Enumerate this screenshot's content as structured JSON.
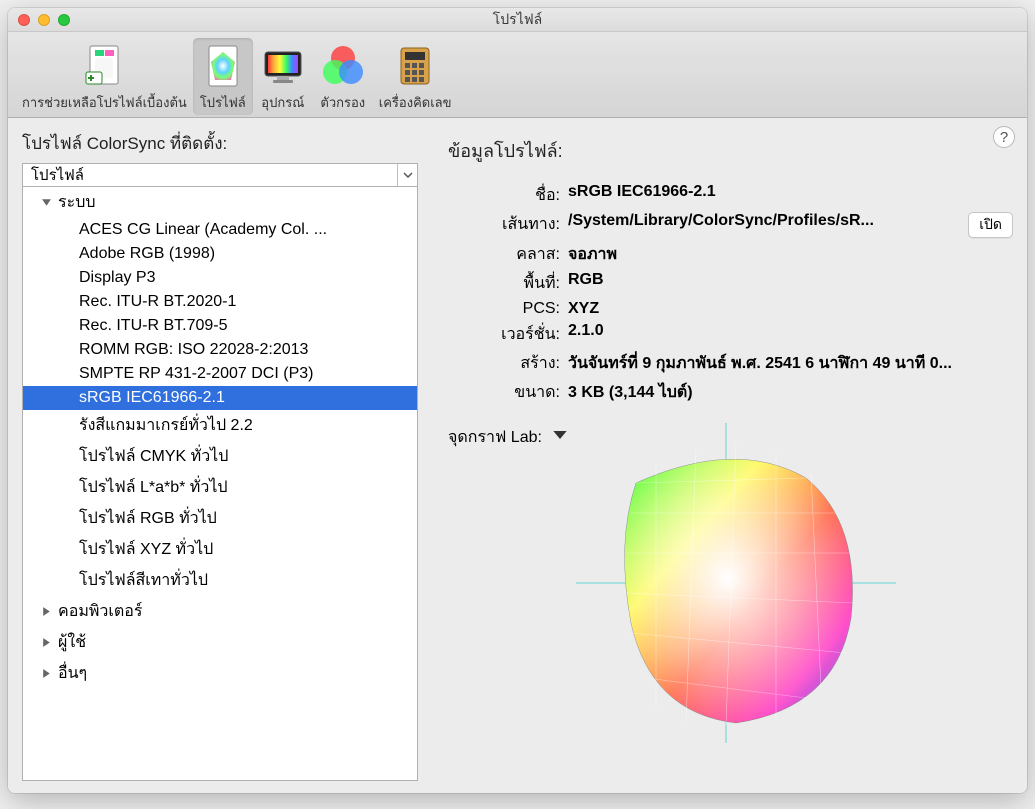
{
  "window": {
    "title": "โปรไฟล์"
  },
  "toolbar": {
    "items": [
      {
        "label": "การช่วยเหลือโปรไฟล์เบื้องต้น"
      },
      {
        "label": "โปรไฟล์"
      },
      {
        "label": "อุปกรณ์"
      },
      {
        "label": "ตัวกรอง"
      },
      {
        "label": "เครื่องคิดเลข"
      }
    ]
  },
  "left": {
    "title": "โปรไฟล์ ColorSync ที่ติดตั้ง:",
    "select_label": "โปรไฟล์",
    "groups": [
      {
        "name": "ระบบ",
        "expanded": true,
        "items": [
          "ACES CG Linear (Academy Col. ...",
          "Adobe RGB (1998)",
          "Display P3",
          "Rec. ITU-R BT.2020-1",
          "Rec. ITU-R BT.709-5",
          "ROMM RGB: ISO 22028-2:2013",
          "SMPTE RP 431-2-2007 DCI (P3)",
          "sRGB IEC61966-2.1",
          "รังสีแกมมาเกรย์ทั่วไป 2.2",
          "โปรไฟล์ CMYK ทั่วไป",
          "โปรไฟล์ L*a*b* ทั่วไป",
          "โปรไฟล์ RGB ทั่วไป",
          "โปรไฟล์ XYZ ทั่วไป",
          "โปรไฟล์สีเทาทั่วไป"
        ]
      },
      {
        "name": "คอมพิวเตอร์",
        "expanded": false,
        "items": []
      },
      {
        "name": "ผู้ใช้",
        "expanded": false,
        "items": []
      },
      {
        "name": "อื่นๆ",
        "expanded": false,
        "items": []
      }
    ],
    "selected": "sRGB IEC61966-2.1"
  },
  "right": {
    "title": "ข้อมูลโปรไฟล์:",
    "labels": {
      "name": "ชื่อ:",
      "path": "เส้นทาง:",
      "class": "คลาส:",
      "space": "พื้นที่:",
      "pcs": "PCS:",
      "version": "เวอร์ชั่น:",
      "created": "สร้าง:",
      "size": "ขนาด:"
    },
    "values": {
      "name": "sRGB IEC61966-2.1",
      "path": "/System/Library/ColorSync/Profiles/sR...",
      "class": "จอภาพ",
      "space": "RGB",
      "pcs": "XYZ",
      "version": "2.1.0",
      "created": "วันจันทร์ที่ 9 กุมภาพันธ์ พ.ศ. 2541 6 นาฬิกา 49 นาที 0...",
      "size": "3 KB (3,144 ไบต์)"
    },
    "open_label": "เปิด",
    "lab_label": "จุดกราฟ Lab:",
    "help": "?"
  }
}
